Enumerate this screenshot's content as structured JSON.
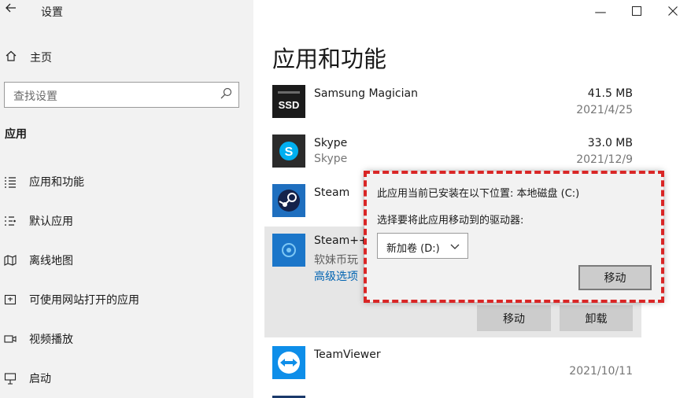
{
  "window": {
    "title": "设置",
    "back_icon": "back-arrow-icon",
    "minimize_glyph": "—",
    "maximize_glyph": "☐",
    "close_glyph": "✕"
  },
  "sidebar": {
    "home_label": "主页",
    "search_placeholder": "查找设置",
    "section_title": "应用",
    "items": [
      {
        "label": "应用和功能",
        "icon": "apps-features-icon"
      },
      {
        "label": "默认应用",
        "icon": "default-apps-icon"
      },
      {
        "label": "离线地图",
        "icon": "offline-maps-icon"
      },
      {
        "label": "可使用网站打开的应用",
        "icon": "apps-for-websites-icon"
      },
      {
        "label": "视频播放",
        "icon": "video-playback-icon"
      },
      {
        "label": "启动",
        "icon": "startup-icon"
      }
    ]
  },
  "main": {
    "title": "应用和功能",
    "apps": [
      {
        "name": "Samsung Magician",
        "subtitle": "",
        "size": "41.5 MB",
        "date": "2021/4/25",
        "icon": "samsung-ssd-icon"
      },
      {
        "name": "Skype",
        "subtitle": "Skype",
        "size": "33.0 MB",
        "date": "2021/12/9",
        "icon": "skype-icon"
      },
      {
        "name": "Steam",
        "subtitle": "",
        "size": "",
        "date": "",
        "icon": "steam-icon"
      }
    ],
    "selected_app": {
      "name": "Steam++",
      "subtitle": "软妹币玩",
      "link": "高级选项",
      "icon": "steampp-icon",
      "move_label": "移动",
      "uninstall_label": "卸载"
    },
    "last_app": {
      "name": "TeamViewer",
      "date": "2021/10/11",
      "icon": "teamviewer-icon"
    }
  },
  "move_dialog": {
    "current_location": "此应用当前已安装在以下位置: 本地磁盘 (C:)",
    "choose_drive": "选择要将此应用移动到的驱动器:",
    "selected_drive": "新加卷 (D:)",
    "move_label": "移动"
  },
  "colors": {
    "sidebar_bg": "#f2f2f2",
    "highlight_border": "#d92626",
    "link": "#0063b1"
  }
}
